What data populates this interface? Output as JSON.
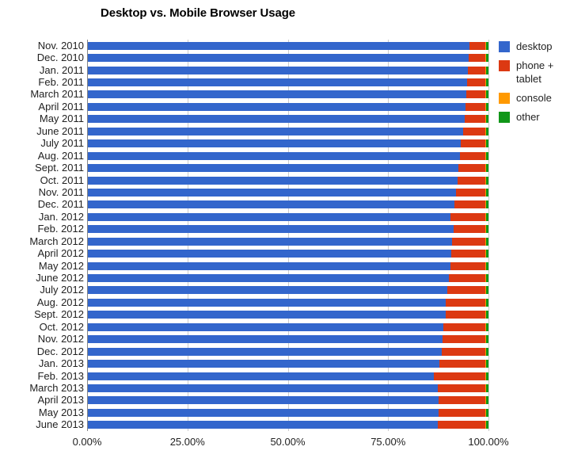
{
  "chart_data": {
    "type": "bar",
    "orientation": "horizontal",
    "stacked": true,
    "title": "Desktop vs. Mobile Browser Usage",
    "xlabel": "",
    "ylabel": "",
    "xlim": [
      0,
      100
    ],
    "xticks": [
      0,
      25,
      50,
      75,
      100
    ],
    "xtick_labels": [
      "0.00%",
      "25.00%",
      "50.00%",
      "75.00%",
      "100.00%"
    ],
    "grid": true,
    "legend_position": "right",
    "categories": [
      "Nov. 2010",
      "Dec. 2010",
      "Jan. 2011",
      "Feb. 2011",
      "March 2011",
      "April 2011",
      "May 2011",
      "June 2011",
      "July 2011",
      "Aug. 2011",
      "Sept. 2011",
      "Oct. 2011",
      "Nov. 2011",
      "Dec. 2011",
      "Jan. 2012",
      "Feb. 2012",
      "March 2012",
      "April 2012",
      "May 2012",
      "June 2012",
      "July 2012",
      "Aug. 2012",
      "Sept. 2012",
      "Oct. 2012",
      "Nov. 2012",
      "Dec. 2012",
      "Jan. 2013",
      "Feb. 2013",
      "March 2013",
      "April 2013",
      "May 2013",
      "June 2013"
    ],
    "series": [
      {
        "name": "desktop",
        "color": "#3366cc",
        "values": [
          95.2,
          95.0,
          94.8,
          94.6,
          94.5,
          94.3,
          94.0,
          93.7,
          93.1,
          92.9,
          92.6,
          92.3,
          92.0,
          91.6,
          90.6,
          91.3,
          91.0,
          90.8,
          90.5,
          90.2,
          89.8,
          89.4,
          89.3,
          88.8,
          88.5,
          88.3,
          87.7,
          86.4,
          87.4,
          87.6,
          87.5,
          87.3
        ]
      },
      {
        "name": "phone + tablet",
        "color": "#dc3912",
        "values": [
          4.1,
          4.3,
          4.5,
          4.7,
          4.8,
          5.0,
          5.3,
          5.6,
          6.2,
          6.4,
          6.7,
          7.0,
          7.3,
          7.7,
          8.7,
          8.0,
          8.3,
          8.5,
          8.8,
          9.1,
          9.5,
          9.9,
          10.0,
          10.5,
          10.8,
          11.0,
          11.6,
          12.9,
          11.9,
          11.7,
          11.8,
          12.0
        ]
      },
      {
        "name": "console",
        "color": "#ff9900",
        "values": [
          0.2,
          0.2,
          0.2,
          0.2,
          0.2,
          0.2,
          0.2,
          0.2,
          0.2,
          0.2,
          0.2,
          0.2,
          0.2,
          0.2,
          0.2,
          0.2,
          0.2,
          0.2,
          0.2,
          0.2,
          0.2,
          0.2,
          0.2,
          0.2,
          0.2,
          0.2,
          0.2,
          0.2,
          0.2,
          0.2,
          0.2,
          0.2
        ]
      },
      {
        "name": "other",
        "color": "#109618",
        "values": [
          0.5,
          0.5,
          0.5,
          0.5,
          0.5,
          0.5,
          0.5,
          0.5,
          0.5,
          0.5,
          0.5,
          0.5,
          0.5,
          0.5,
          0.5,
          0.5,
          0.5,
          0.5,
          0.5,
          0.5,
          0.5,
          0.5,
          0.5,
          0.5,
          0.5,
          0.5,
          0.5,
          0.5,
          0.5,
          0.5,
          0.5,
          0.5
        ]
      }
    ]
  },
  "legend": {
    "items": [
      {
        "label": "desktop",
        "color": "#3366cc"
      },
      {
        "label": "phone + tablet",
        "color": "#dc3912"
      },
      {
        "label": "console",
        "color": "#ff9900"
      },
      {
        "label": "other",
        "color": "#109618"
      }
    ]
  },
  "axis": {
    "grid_color": "#cccccc",
    "axis_color": "#848484",
    "text_color": "#222222"
  }
}
